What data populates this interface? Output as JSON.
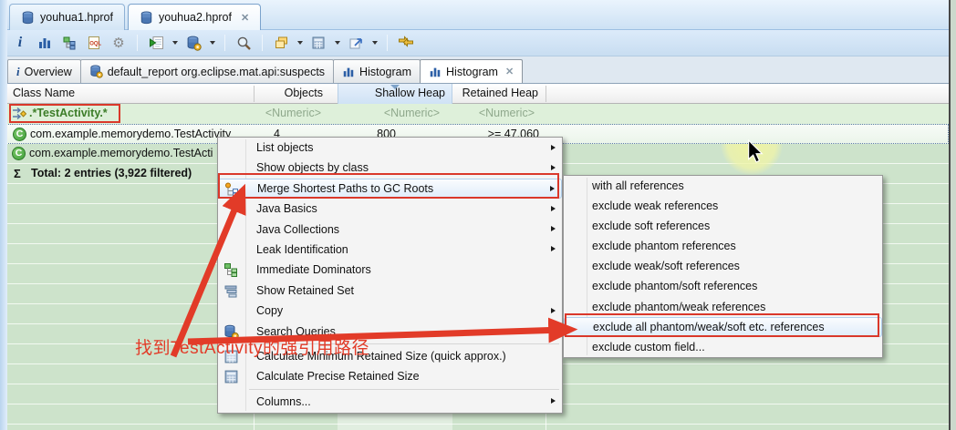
{
  "colors": {
    "annotation_red": "#e23b28",
    "selection_blue": "#dfecfa",
    "table_green": "#cde3cb",
    "sort_header_blue": "#d6e6f7",
    "filter_text_green": "#3c7d28"
  },
  "glyphs": {
    "close": "✕",
    "sum": "Σ",
    "gear": "⚙",
    "info": "i"
  },
  "editor_tabs": [
    {
      "label": "youhua1.hprof"
    },
    {
      "label": "youhua2.hprof"
    }
  ],
  "toolbar": {
    "icons": [
      "overview",
      "histogram",
      "dominator-tree",
      "oql",
      "settings",
      "run-expert-report",
      "open-query-browser",
      "search",
      "group-by",
      "calculator",
      "export",
      "compare"
    ]
  },
  "view_tabs": [
    {
      "label": "Overview"
    },
    {
      "label": "default_report org.eclipse.mat.api:suspects"
    },
    {
      "label": "Histogram"
    },
    {
      "label": "Histogram"
    }
  ],
  "table": {
    "columns": [
      "Class Name",
      "Objects",
      "Shallow Heap",
      "Retained Heap"
    ],
    "filter": {
      "pattern": ".*TestActivity.*",
      "placeholder": "<Numeric>"
    },
    "rows": [
      {
        "class_name": "com.example.memorydemo.TestActivity",
        "objects": "4",
        "shallow_heap": "800",
        "retained_heap": ">= 47,060"
      },
      {
        "class_name": "com.example.memorydemo.TestActi"
      }
    ],
    "total": "Total: 2 entries (3,922 filtered)"
  },
  "context_menu": {
    "items": [
      {
        "label": "List objects"
      },
      {
        "label": "Show objects by class"
      },
      {
        "label": "Merge Shortest Paths to GC Roots"
      },
      {
        "label": "Java Basics"
      },
      {
        "label": "Java Collections"
      },
      {
        "label": "Leak Identification"
      },
      {
        "label": "Immediate Dominators"
      },
      {
        "label": "Show Retained Set"
      },
      {
        "label": "Copy"
      },
      {
        "label": "Search Queries..."
      },
      {
        "label": "Calculate Minimum Retained Size (quick approx.)"
      },
      {
        "label": "Calculate Precise Retained Size"
      },
      {
        "label": "Columns..."
      }
    ]
  },
  "gc_roots_submenu": {
    "items": [
      "with all references",
      "exclude weak references",
      "exclude soft references",
      "exclude phantom references",
      "exclude weak/soft references",
      "exclude phantom/soft references",
      "exclude phantom/weak references",
      "exclude all phantom/weak/soft etc. references",
      "exclude custom field..."
    ]
  },
  "annotation": {
    "text": "找到TestActivity的强引用路径"
  }
}
